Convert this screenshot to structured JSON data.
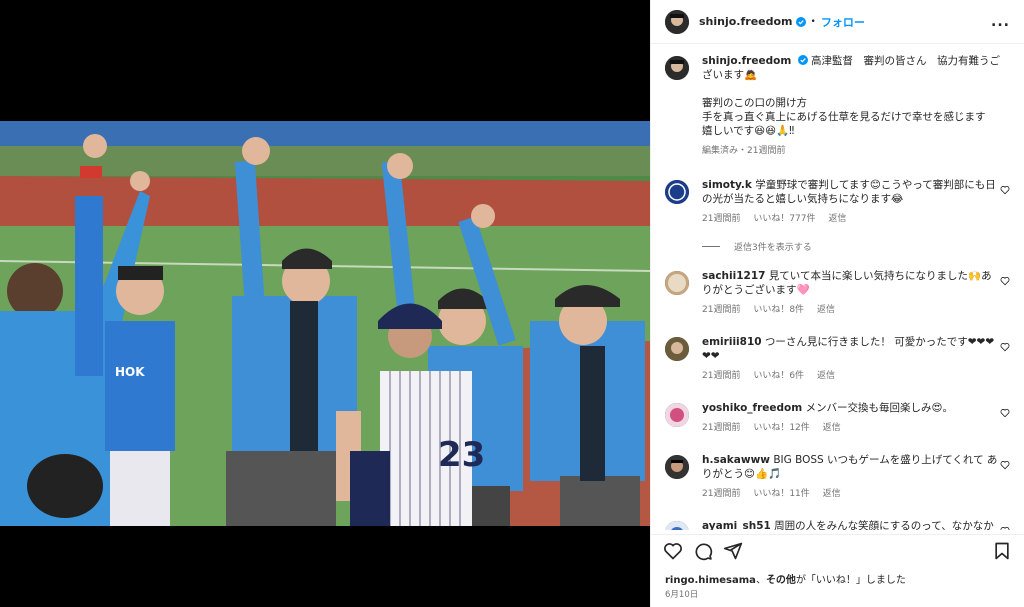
{
  "post_author": {
    "username": "shinjo.freedom",
    "dot": "•",
    "follow_label": "フォロー",
    "more_label": "..."
  },
  "caption": {
    "username": "shinjo.freedom",
    "line1": "高津監督　審判の皆さん　協力有難うございます🙇",
    "line2": "審判のこの口の開け方",
    "line3": "手を真っ直ぐ真上にあげる仕草を見るだけで幸せを感じます",
    "line4": "嬉しいです😆😆🙏‼",
    "meta": "編集済み・21週間前"
  },
  "comments": [
    {
      "username": "simoty.k",
      "text": "学童野球で審判してます😊こうやって審判部にも日の光が当たると嬉しい気持ちになります😂",
      "time": "21週間前",
      "likes": "いいね！777件",
      "reply": "返信"
    },
    {
      "username": "sachii1217",
      "text": "見ていて本当に楽しい気持ちになりました🙌ありがとうございます🩷",
      "time": "21週間前",
      "likes": "いいね！8件",
      "reply": "返信"
    },
    {
      "username": "emiriii810",
      "text": "つーさん見に行きました！ 可愛かったです❤❤❤❤❤",
      "time": "21週間前",
      "likes": "いいね！6件",
      "reply": "返信"
    },
    {
      "username": "yoshiko_freedom",
      "text": "メンバー交換も毎回楽しみ😍。",
      "time": "21週間前",
      "likes": "いいね！12件",
      "reply": "返信"
    },
    {
      "username": "h.sakawww",
      "text": "BIG BOSS いつもゲームを盛り上げてくれて ありがとう😊👍🎵",
      "time": "21週間前",
      "likes": "いいね！11件",
      "reply": "返信"
    },
    {
      "username": "ayami_sh51",
      "text": "周囲の人をみんな笑顔にするのって、なかなかで",
      "time": "",
      "likes": "",
      "reply": ""
    }
  ],
  "view_replies": "返信3件を表示する",
  "likes_line": {
    "user": "ringo.himesama",
    "text_mid": "、",
    "others": "その他",
    "text_end": "が「いいね！」しました"
  },
  "date": "6月10日",
  "icons": [
    "verified-icon",
    "heart-icon",
    "comment-icon",
    "share-icon",
    "bookmark-icon",
    "more-icon"
  ],
  "colors": {
    "accent": "#0095f6",
    "muted": "#737373",
    "umpire_shirt": "#3f8fd6"
  }
}
